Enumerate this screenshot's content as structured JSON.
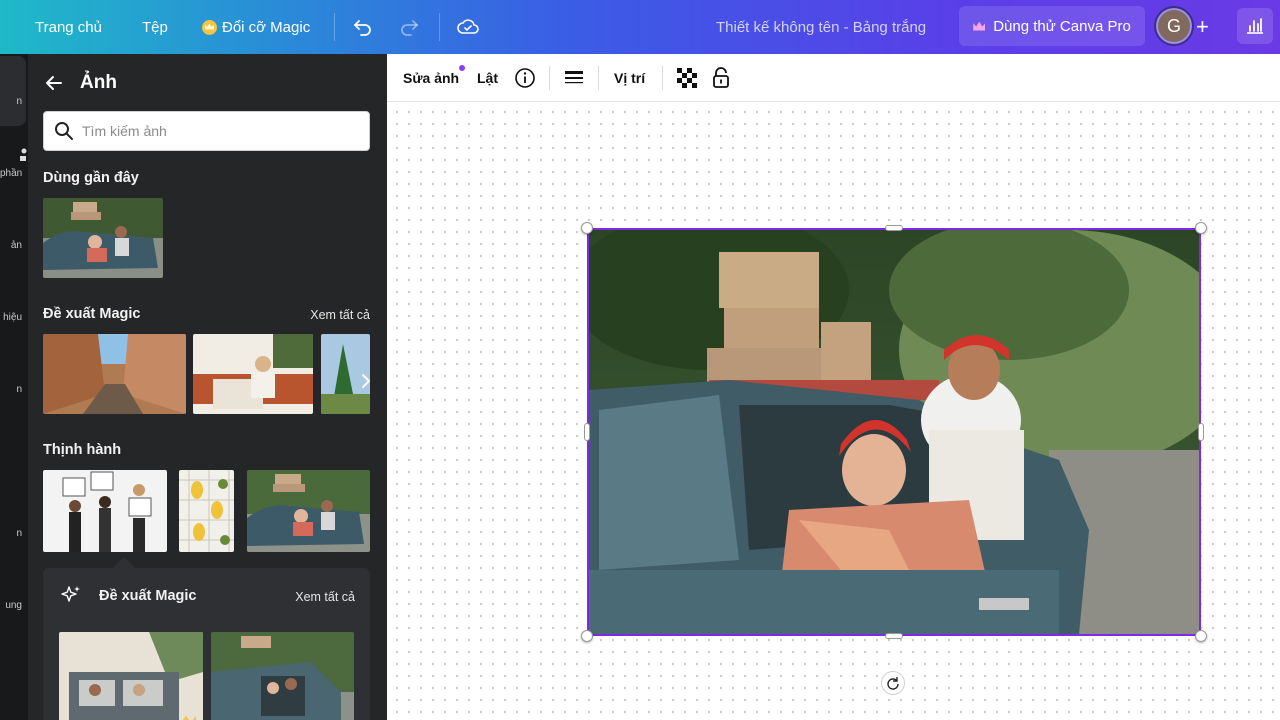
{
  "topbar": {
    "home": "Trang chủ",
    "file": "Tệp",
    "magic_resize": "Đổi cỡ Magic",
    "doc_title": "Thiết kế không tên - Bảng trắng",
    "pro_button": "Dùng thử Canva Pro",
    "avatar_initial": "G",
    "icons": [
      "undo-icon",
      "redo-icon",
      "cloud-saved-icon",
      "plus-icon",
      "stats-icon"
    ]
  },
  "rail": {
    "items": [
      "n",
      "phần",
      "ản",
      "hiệu",
      "n",
      "n",
      "ung"
    ]
  },
  "panel": {
    "title": "Ảnh",
    "search_placeholder": "Tìm kiếm ảnh",
    "recent_title": "Dùng gần đây",
    "magic_title": "Đề xuất Magic",
    "magic_see_all": "Xem tất cả",
    "trending_title": "Thịnh hành",
    "magic_box_title": "Đề xuất Magic",
    "magic_box_see_all": "Xem tất cả"
  },
  "editbar": {
    "edit_photo": "Sửa ảnh",
    "flip": "Lật",
    "position": "Vị trí",
    "icons": [
      "info-icon",
      "lines-icon",
      "transparency-icon",
      "lock-icon"
    ]
  },
  "colors": {
    "selection": "#7d2ae8",
    "notify_dot": "#8b3dff",
    "panel_bg": "#252627"
  }
}
